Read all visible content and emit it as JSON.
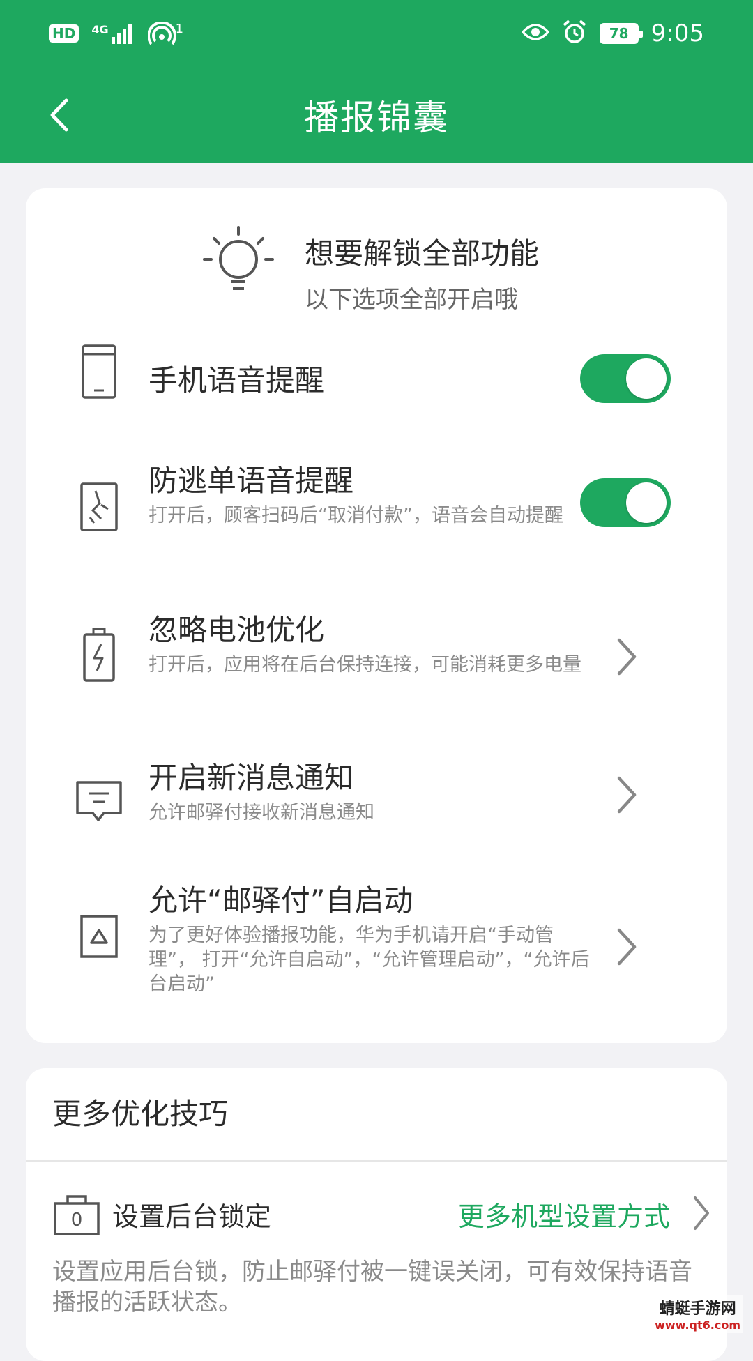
{
  "status_bar": {
    "hd": "HD",
    "network": "4G",
    "hotspot_count": "1",
    "battery": "78",
    "time": "9:05"
  },
  "nav": {
    "title": "播报锦囊"
  },
  "tip": {
    "title": "想要解锁全部功能",
    "subtitle": "以下选项全部开启哦"
  },
  "settings": [
    {
      "title": "手机语音提醒",
      "desc": "",
      "control": "toggle",
      "enabled": true
    },
    {
      "title": "防逃单语音提醒",
      "desc": "打开后，顾客扫码后“取消付款”，语音会自动提醒",
      "control": "toggle",
      "enabled": true
    },
    {
      "title": "忽略电池优化",
      "desc": "打开后，应用将在后台保持连接，可能消耗更多电量",
      "control": "chevron"
    },
    {
      "title": "开启新消息通知",
      "desc": "允许邮驿付接收新消息通知",
      "control": "chevron"
    },
    {
      "title": "允许“邮驿付”自启动",
      "desc": "为了更好体验播报功能，华为手机请开启“手动管理”， 打开“允许自启动”，“允许管理启动”，“允许后台启动”",
      "control": "chevron"
    }
  ],
  "more": {
    "title": "更多优化技巧",
    "lock_label": "设置后台锁定",
    "lock_link": "更多机型设置方式",
    "desc": "设置应用后台锁，防止邮驿付被一键误关闭，可有效保持语音播报的活跃状态。"
  },
  "watermark": {
    "line1": "蜻蜓手游网",
    "line2": "www.qt6.com"
  },
  "colors": {
    "brand": "#1ea85f",
    "background": "#f2f2f5"
  }
}
